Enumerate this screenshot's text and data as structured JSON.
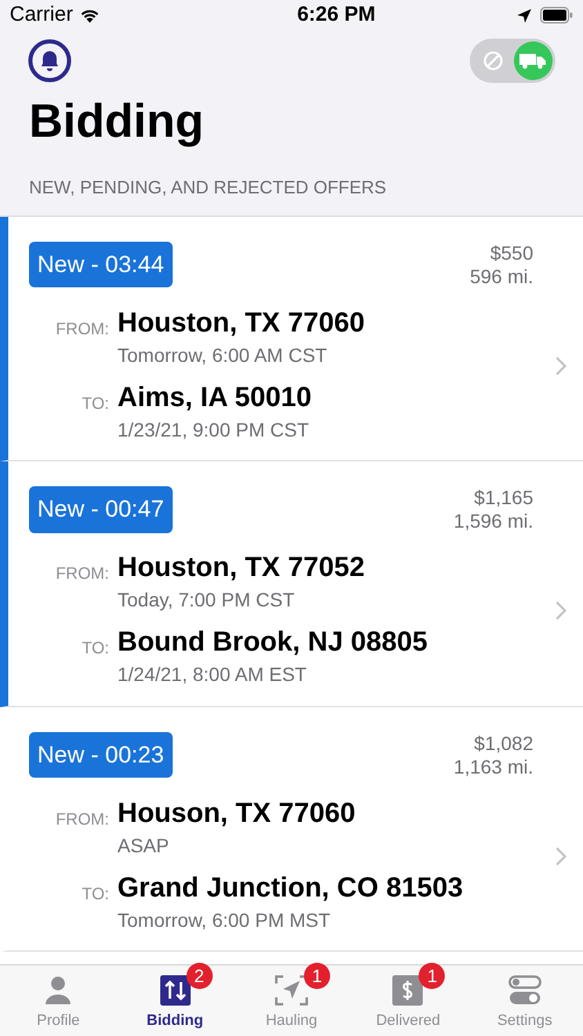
{
  "status_bar": {
    "carrier": "Carrier",
    "time": "6:26 PM"
  },
  "header": {
    "title": "Bidding",
    "availability_toggle": {
      "on": true
    }
  },
  "section_header": "NEW, PENDING, AND REJECTED OFFERS",
  "offers": [
    {
      "badge": "New - 03:44",
      "price": "$550",
      "distance": "596 mi.",
      "from_label": "FROM:",
      "from": "Houston, TX 77060",
      "from_time": "Tomorrow, 6:00 AM CST",
      "to_label": "TO:",
      "to": "Aims, IA 50010",
      "to_time": "1/23/21, 9:00 PM CST",
      "selected": true
    },
    {
      "badge": "New - 00:47",
      "price": "$1,165",
      "distance": "1,596 mi.",
      "from_label": "FROM:",
      "from": "Houston, TX 77052",
      "from_time": "Today, 7:00 PM CST",
      "to_label": "TO:",
      "to": "Bound Brook, NJ 08805",
      "to_time": "1/24/21, 8:00 AM EST",
      "selected": true
    },
    {
      "badge": "New - 00:23",
      "price": "$1,082",
      "distance": "1,163 mi.",
      "from_label": "FROM:",
      "from": "Houson, TX 77060",
      "from_time": "ASAP",
      "to_label": "TO:",
      "to": "Grand Junction, CO 81503",
      "to_time": "Tomorrow, 6:00 PM MST",
      "selected": false
    }
  ],
  "tab_bar": [
    {
      "kind": "profile",
      "label": "Profile",
      "selected": false
    },
    {
      "kind": "bidding",
      "label": "Bidding",
      "badge": "2",
      "selected": true
    },
    {
      "kind": "hauling",
      "label": "Hauling",
      "badge": "1",
      "selected": false
    },
    {
      "kind": "delivered",
      "label": "Delivered",
      "badge": "1",
      "selected": false
    },
    {
      "kind": "settings",
      "label": "Settings",
      "selected": false
    }
  ]
}
